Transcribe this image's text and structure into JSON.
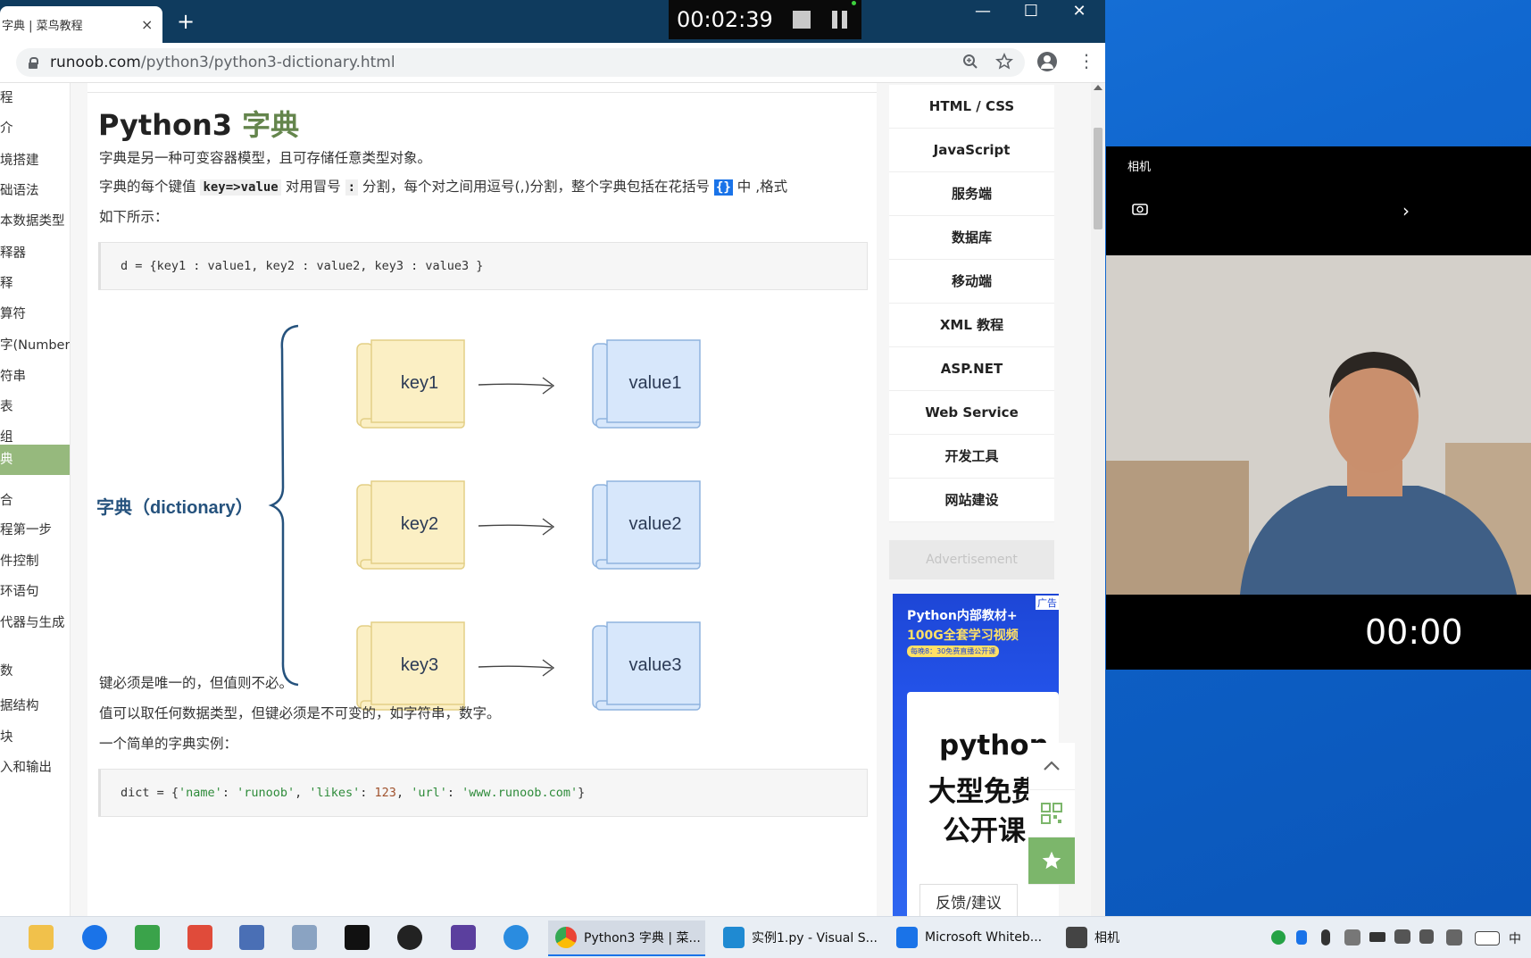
{
  "browser": {
    "tab_title": "字典 | 菜鸟教程",
    "tab_close": "×",
    "new_tab": "+",
    "window_controls": {
      "minimize": "—",
      "maximize": "☐",
      "close": "✕"
    },
    "url_host": "runoob.com",
    "url_path": "/python3/python3-dictionary.html"
  },
  "recorder": {
    "time": "00:02:39"
  },
  "left_nav": {
    "items": [
      {
        "label": "程",
        "active": false
      },
      {
        "label": "介",
        "active": false
      },
      {
        "label": "境搭建",
        "active": false
      },
      {
        "label": "础语法",
        "active": false
      },
      {
        "label": "本数据类型",
        "active": false
      },
      {
        "label": "释器",
        "active": false
      },
      {
        "label": "释",
        "active": false
      },
      {
        "label": "算符",
        "active": false
      },
      {
        "label": "字(Number)",
        "active": false
      },
      {
        "label": "符串",
        "active": false
      },
      {
        "label": "表",
        "active": false
      },
      {
        "label": "组",
        "active": false
      },
      {
        "label": "典",
        "active": true
      },
      {
        "label": "合",
        "active": false
      },
      {
        "label": "程第一步",
        "active": false
      },
      {
        "label": "件控制",
        "active": false
      },
      {
        "label": "环语句",
        "active": false
      },
      {
        "label": "代器与生成",
        "active": false
      },
      {
        "label": "数",
        "active": false
      },
      {
        "label": "据结构",
        "active": false
      },
      {
        "label": "块",
        "active": false
      },
      {
        "label": "入和输出",
        "active": false
      }
    ]
  },
  "article": {
    "title_prefix": "Python3",
    "title_accent": "字典",
    "p1": "字典是另一种可变容器模型，且可存储任意类型对象。",
    "p2_a": "字典的每个键值",
    "p2_code1": "key=>value",
    "p2_b": "对用冒号",
    "p2_code2": ":",
    "p2_c": "分割，每个对之间用逗号(,)分割，整个字典包括在花括号",
    "p2_code3": "{}",
    "p2_d": "中 ,格式",
    "p3": "如下所示：",
    "code1": "d = {key1 : value1, key2 : value2, key3 : value3 }",
    "p4": "键必须是唯一的，但值则不必。",
    "p5": "值可以取任何数据类型，但键必须是不可变的，如字符串，数字。",
    "p6": "一个简单的字典实例：",
    "code2_prefix": "dict = {",
    "code2_k1": "'name'",
    "code2_v1": "'runoob'",
    "code2_k2": "'likes'",
    "code2_v2": "123",
    "code2_k3": "'url'",
    "code2_v3": "'www.runoob.com'",
    "code2_suffix": "}"
  },
  "diagram": {
    "label": "字典（dictionary）",
    "pairs": [
      {
        "key": "key1",
        "value": "value1"
      },
      {
        "key": "key2",
        "value": "value2"
      },
      {
        "key": "key3",
        "value": "value3"
      }
    ],
    "colors": {
      "key_fill": "#fbefc4",
      "key_stroke": "#e3cf86",
      "value_fill": "#d7e7fb",
      "value_stroke": "#8fb3de",
      "brace": "#25527d"
    }
  },
  "right_nav": {
    "items": [
      "HTML / CSS",
      "JavaScript",
      "服务端",
      "数据库",
      "移动端",
      "XML 教程",
      "ASP.NET",
      "Web Service",
      "开发工具",
      "网站建设"
    ],
    "ad_label": "Advertisement",
    "ad": {
      "tag": "广告",
      "line1": "Python内部教材+",
      "line2": "100G全套学习视频",
      "line3": "每晚8：30免费直播公开课",
      "card1": "python",
      "card2": "大型免费",
      "card3": "公开课"
    },
    "feedback": "反馈/建议"
  },
  "camera": {
    "title": "相机",
    "timer": "00:00"
  },
  "taskbar": {
    "apps": [
      {
        "label": "Python3 字典 | 菜...",
        "active": true
      },
      {
        "label": "实例1.py - Visual S...",
        "active": false
      },
      {
        "label": "Microsoft Whiteb...",
        "active": false
      },
      {
        "label": "相机",
        "active": false
      }
    ],
    "ime": "中"
  }
}
